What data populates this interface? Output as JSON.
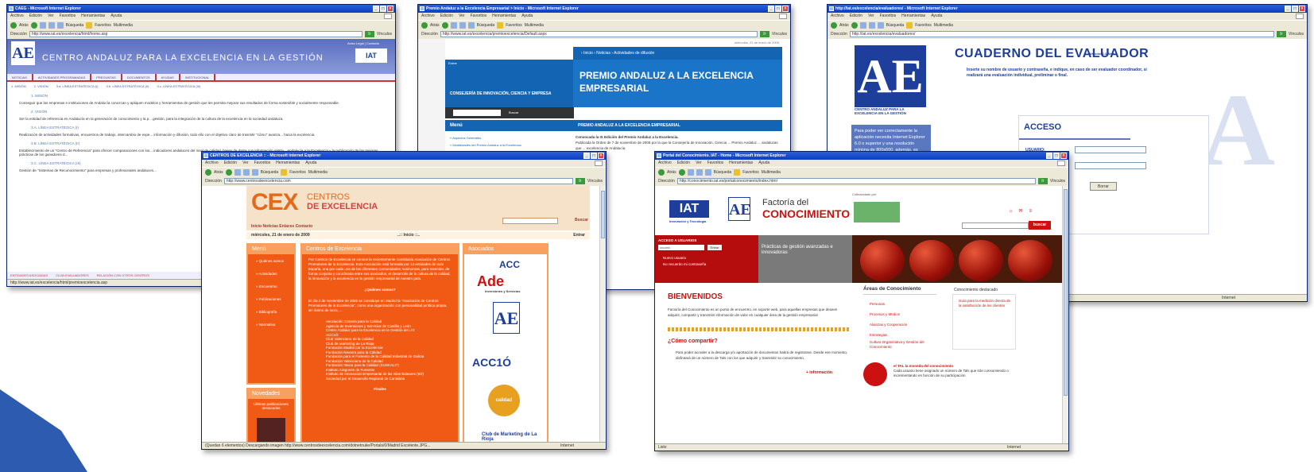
{
  "browser": {
    "menu": [
      "Archivo",
      "Edición",
      "Ver",
      "Favoritos",
      "Herramientas",
      "Ayuda"
    ],
    "toolbar": [
      "Atrás",
      "Búsqueda",
      "Favoritos",
      "Multimedia"
    ],
    "address_label": "Dirección",
    "go_label": "Ir",
    "links_label": "Vínculos",
    "status_internet": "Internet"
  },
  "win_caeg": {
    "title": "CAEG - Microsoft Internet Explorer",
    "url": "http://www.iat.es/excelencia/html/home.asp",
    "header_title": "CENTRO ANDALUZ PARA LA EXCELENCIA EN LA GESTIÓN",
    "logo": "AE",
    "toplinks": "Aviso Legal | Contacto",
    "iat_logo": "IAT",
    "nav": [
      "NOTICIAS",
      "ACTIVIDADES PROGRAMADAS",
      "PREGUNTAS",
      "DOCUMENTOS",
      "AYUDAS",
      "INSTITUCIONAL"
    ],
    "subnav": [
      "1. MISIÓN",
      "2. VISIÓN",
      "3.a. LÍNEA ESTRATÉGICA (I)",
      "3.b. LÍNEA ESTRATÉGICA (II)",
      "3.c. LÍNEA ESTRATÉGICA (III)"
    ],
    "h1": "1. MISIÓN",
    "p1": "Conseguir que las empresas e instituciones de Andalucía conozcan y apliquen modelos y herramientas de gestión que les permita mejorar sus resultados de forma sostenible y socialmente responsable.",
    "h2": "2. VISIÓN",
    "p2": "Ser la entidad de referencia en Andalucía en la generación de conocimiento y la p... gestión, para la integración de la cultura de la excelencia en la sociedad andaluza.",
    "h3": "3.A. LÍNEA ESTRATÉGICA (I)",
    "p3": "Realización de actividades formativas, encuentros de trabajo, intercambio de expe... información y difusión, todo ello con el objetivo claro de trasmitir \"cómo\" avanza... hacia la excelencia.",
    "h4": "3.B. LÍNEA ESTRATÉGICA (II)",
    "p4": "Establecimiento de un \"Centro de Referencia\" para ofrecer comparaciones con los... indicadores andaluces del nivel de calidad, bases de datos con información relativ... Andalucía a la Excelencia y la publicación de las mejores prácticas de los ganadores d...",
    "h5": "3.C. LÍNEA ESTRATÉGICA (III)",
    "p5": "Gestión de \"Sistemas de Reconocimiento\" para empresas y profesionales andaluces...",
    "footer": [
      "ENTIDADES ASOCIADAS",
      "CLUB EVALUADORES",
      "RELACIÓN CON OTROS CENTROS"
    ],
    "status": "http://www.iat.es/excelencia/html/premioexcelencia.asp"
  },
  "win_premio": {
    "title": "Premio Andaluz a la Excelencia Empresarial > Inicio - Microsoft Internet Explorer",
    "url": "http://www.iat.es/excelencia/premioexcelencia/Default.aspx",
    "date": "miércoles, 21 de enero de 2009",
    "links": "› Inicio  › Noticias  › Actividades de difusión",
    "consejeria": "CONSEJERÍA DE INNOVACIÓN, CIENCIA Y EMPRESA",
    "entrar": "Entrar",
    "buscar": "Buscar",
    "premio_title": "PREMIO ANDALUZ A LA EXCELENCIA EMPRESARIAL",
    "menu": "Menú",
    "menu_items": [
      "» Aspectos Generales",
      "» Modalidades del Premio Andaluz a la Excelencia"
    ],
    "right_head": "PREMIO ANDALUZ A LA EXCELENCIA EMPRESARIAL",
    "right_line1": "Convocada la IX Edición del Premio Andaluz a la Excelencia.",
    "right_line2": "Publicada la Orden de 7 de noviembre de 2008 por la que la Consejería de Innovación, Ciencia ... Premio Andaluz ... andaluzas que ... excelencia de Andalucía."
  },
  "win_cuaderno": {
    "title": "http://iat.es/excelencia/evaluadores/ - Microsoft Internet Explorer",
    "url": "http://iat.es/excelencia/evaluadores/",
    "logo": "AE",
    "logo_caption": "CENTRO ANDALUZ PARA LA EXCELENCIA EN LA GESTIÓN",
    "heading": "CUADERNO DEL EVALUADOR",
    "version": "Versión 1.3 Beta",
    "instructions": "Inserte su nombre de usuario y contraseña, e indique, en caso de ser evaluador coordinador, si realizará una evaluación individual, preliminar o final.",
    "side_text": "Para poder ver correctamente la aplicación necesita Internet Explorer 6.0 o superior y una resolución mínima de 800x600, además, es recomendable descargar el siguiente archivo. desconocimiento en su equipo y ejecutar el",
    "acceso": "ACCESO",
    "usuario_label": "USUARIO:",
    "borrar": "Borrar"
  },
  "win_cex": {
    "title": "CENTROS DE EXCELENCIA :: - Microsoft Internet Explorer",
    "url": "http://www.centrosdeexcelencia.com",
    "logo": "CEX",
    "logo_line1": "CENTROS",
    "logo_line2": "DE EXCELENCIA",
    "nav": "Inicio  Noticias  Enlaces  Contacto",
    "buscar": "Buscar",
    "date": "miércoles, 21 de enero de 2009",
    "inicio": "..:: Inicio ::..",
    "entrar": "Entrar",
    "menu_title": "Menú",
    "menu_items": [
      "» Quiénes somos",
      "» Actividades",
      "» Encuentros",
      "» Publicaciones",
      "» Bibliografía",
      "» Normativa"
    ],
    "centros_title": "Centros de Excelencia",
    "centros_text": "Por Centros de Excelencia se conoce la recientemente constituida Asociación de Centros Promotores de la Excelencia. Esta Asociación está formada por 14 entidades de todo España, una por cada una de las diferentes Comunidades Autónomas, para extender, de forma conjunta y coordinada entre sus asociados, el desarrollo de la cultura de la calidad, la innovación y la excelencia en la gestión empresarial de nuestro país.",
    "quienes": "¿Quiénes somos?",
    "quienes_text": "El día 2 de Noviembre de 2006 se constituye en Madrid la \"Asociación de Centros Promotores de la Excelencia\", como una organización con personalidad jurídica propia, sin ánimo de lucro, ...",
    "members": [
      "Asociación Canaria para la Calidad",
      "Agencia de Inversiones y Servicios de Castilla y León",
      "Centro Andaluz para la Excelencia en la Gestión del IAT",
      "ACC1Ó",
      "Club Valenciano de la Calidad",
      "Club de Marketing de La Rioja",
      "Fundación Madrid por la Excelencia",
      "Fundación Navarra para la Calidad",
      "Fundación para el Fomento de la Calidad Industrial de Galicia",
      "Fundación Valenciana de la Calidad",
      "Fundación Vasca para la Calidad (EUSKALIT)",
      "Instituto Aragonés de Fomento",
      "Instituto de Innovación Empresarial de las Islas Baleares (IDI)",
      "Sociedad por el Desarrollo Regional de Cantabria"
    ],
    "finales": "Finales",
    "novedades": "Novedades",
    "novedades_text": "Últimas publicaciones destacadas",
    "asociados": "Asociados",
    "logos": [
      "ACC",
      "Ade",
      "AE",
      "ACC1Ó",
      "calidad",
      "Club de Marketing de La Rioja"
    ],
    "ade_sub": "Inversiones y Servicios",
    "status": "(Quedan 6 elementos) Descargando imagen http://www.centrosdeexcelencia.com/dotnetnuke/Portals/0/Madrid Excelente.JPG..."
  },
  "win_iat": {
    "title": "Portal del Conocimiento. IAT - Home - Microsoft Internet Explorer",
    "url": "http://conocimiento.iat.es/portalconocimiento/index.html",
    "iat": "IAT",
    "iat_caption": "Innovación y Tecnología",
    "ae": "AE",
    "factoria1": "Factoría del",
    "factoria2": "CONOCIMIENTO",
    "cofinanciado": "Cofinanciado por",
    "buscar": "buscar",
    "acceso": "ACCESO A USUARIOS",
    "usuario": "usuario",
    "entrar": "Entrar",
    "nuevo": "Nuevo usuario",
    "recuerdo": "No recuerdo mi contraseña",
    "practicas": "Prácticas de gestión avanzadas e innovadoras",
    "bienvenidos": "BIENVENIDOS",
    "bien_text": "Factoría del Conocimiento es un punto de encuentro, en soporte web, para aquellas empresas que deseen adquirir, compartir y transmitir información de valor en cualquier área de la gestión empresarial",
    "como": "¿Cómo compartir?",
    "como_text": "Para poder acceder a la descarga y/o aportación de documentos habrá de registrarse. Desde ese momento, disfrutará de un número de Tals con los que adquirir y transmitir su conocimiento.",
    "mas": "+ información",
    "areas_title": "Áreas de Conocimiento",
    "areas": [
      "Personas",
      "Procesos y Medios",
      "Alianzas y Cooperación",
      "Estrategias",
      "Cultura Organizativa y Gestión del Conocimiento"
    ],
    "destacado_title": "Conocimiento destacado",
    "destacado": "Guía para la medición directa de la satisfacción de los clientes",
    "tal_title": "el TAL la moneda del conocimiento",
    "tal_text": "Cada usuario tiene asignado un número de Tals que irán consumiendo o incrementando en función de su participación",
    "status": "Listo"
  }
}
